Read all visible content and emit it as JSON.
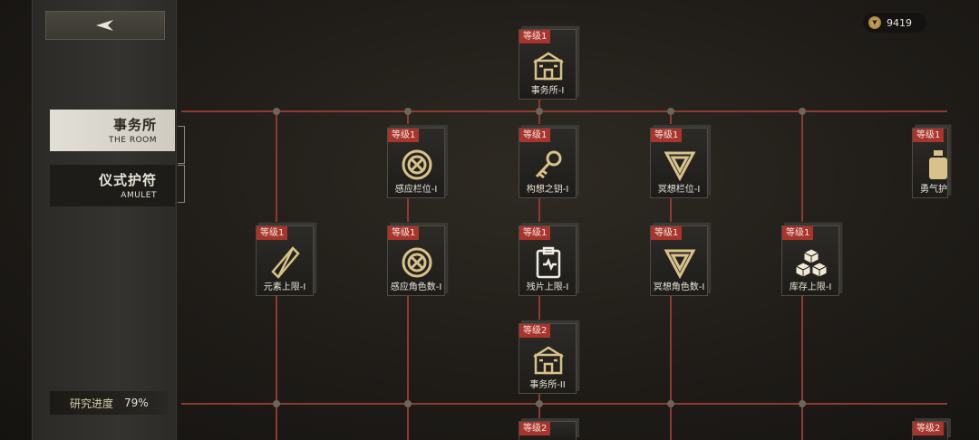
{
  "back_button": {
    "icon": "back-arrow-icon"
  },
  "currency": {
    "icon": "coin-icon",
    "amount": "9419"
  },
  "tabs": [
    {
      "zh": "事务所",
      "en": "THE ROOM",
      "active": true
    },
    {
      "zh": "仪式护符",
      "en": "AMULET",
      "active": false
    }
  ],
  "progress": {
    "label": "研究进度",
    "value": "79%"
  },
  "colors": {
    "level_badge": "#a8342b",
    "line": "#8f3a2e",
    "icon_gold": "#d9c28a"
  },
  "nodes": [
    {
      "level": "等级1",
      "name": "事务所-I",
      "icon": "building-icon"
    },
    {
      "level": "等级1",
      "name": "感应栏位-I",
      "icon": "crosshair-circle-icon"
    },
    {
      "level": "等级1",
      "name": "构想之钥-I",
      "icon": "key-icon"
    },
    {
      "level": "等级1",
      "name": "冥想栏位-I",
      "icon": "triangle-eye-icon"
    },
    {
      "level": "等级1",
      "name": "勇气护",
      "icon": "bottle-icon"
    },
    {
      "level": "等级1",
      "name": "元素上限-I",
      "icon": "crystal-icon"
    },
    {
      "level": "等级1",
      "name": "感应角色数-I",
      "icon": "crosshair-circle-icon"
    },
    {
      "level": "等级1",
      "name": "残片上限-I",
      "icon": "clipboard-heart-icon"
    },
    {
      "level": "等级1",
      "name": "冥想角色数-I",
      "icon": "triangle-eye-icon"
    },
    {
      "level": "等级1",
      "name": "库存上限-I",
      "icon": "boxes-icon"
    },
    {
      "level": "等级2",
      "name": "事务所-II",
      "icon": "building-icon"
    },
    {
      "level": "等级2",
      "name": "",
      "icon": "building-icon"
    },
    {
      "level": "等级2",
      "name": "",
      "icon": "building-icon"
    }
  ]
}
